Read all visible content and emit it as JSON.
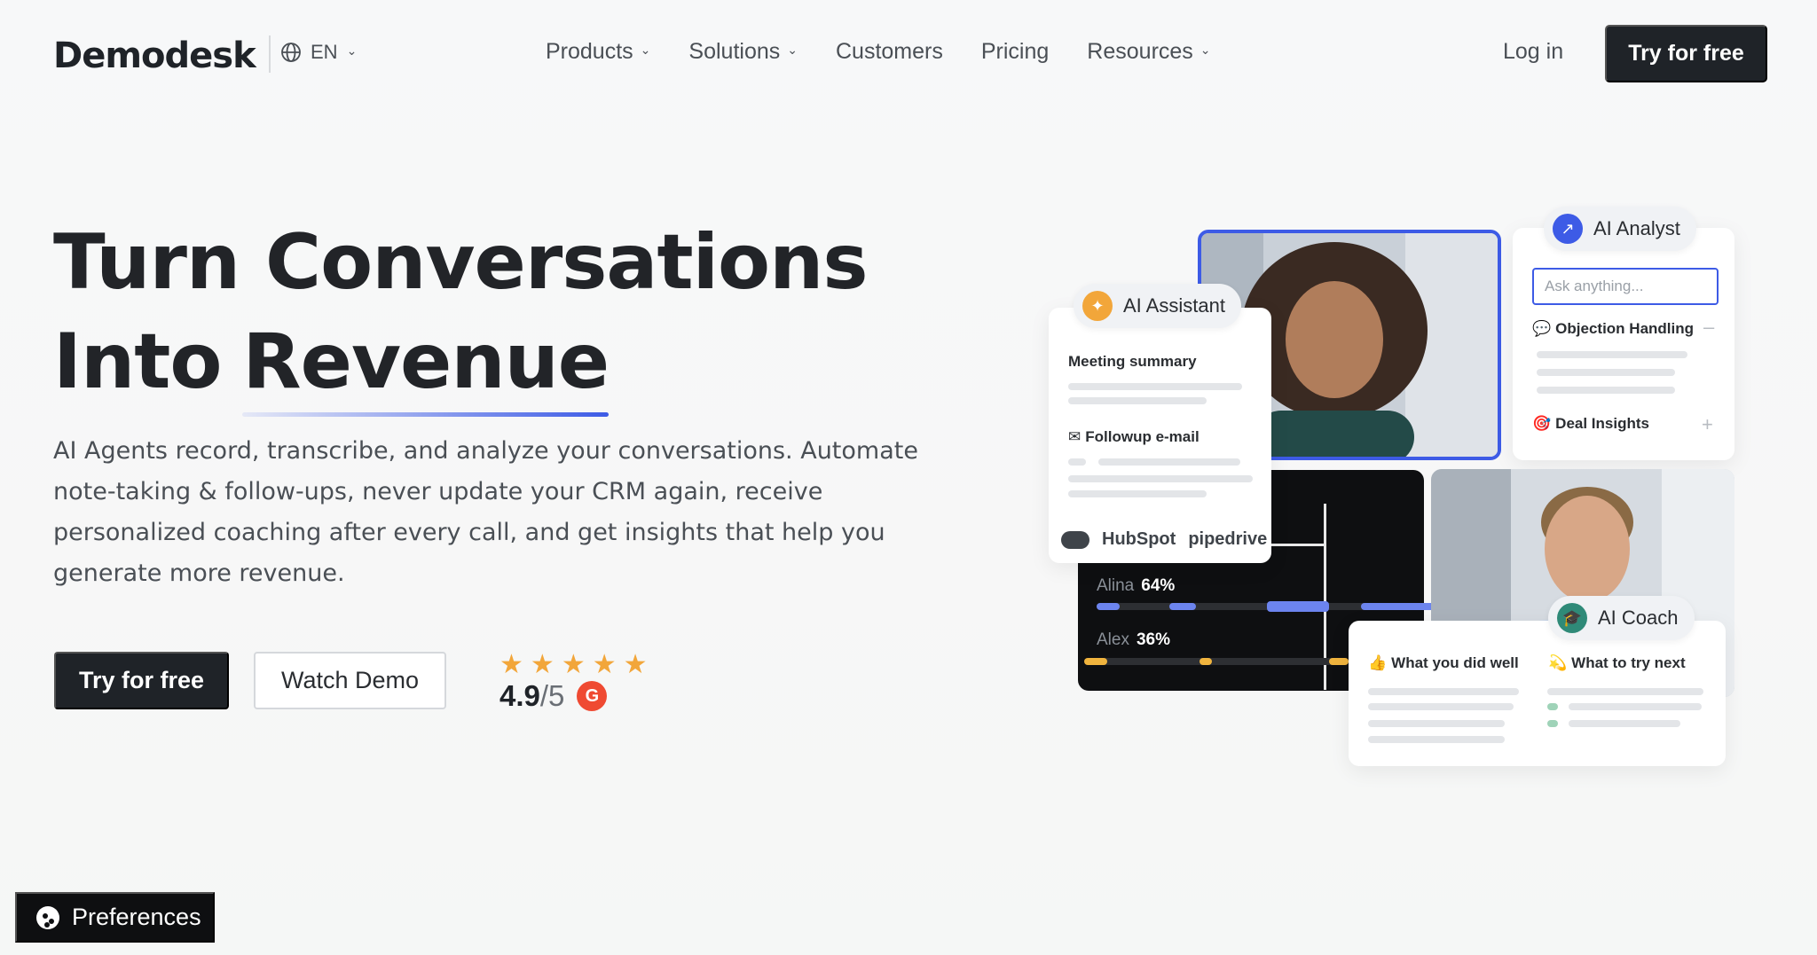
{
  "header": {
    "logo": "Demodesk",
    "language": "EN",
    "nav": [
      {
        "label": "Products",
        "has_dropdown": true
      },
      {
        "label": "Solutions",
        "has_dropdown": true
      },
      {
        "label": "Customers",
        "has_dropdown": false
      },
      {
        "label": "Pricing",
        "has_dropdown": false
      },
      {
        "label": "Resources",
        "has_dropdown": true
      }
    ],
    "login": "Log in",
    "cta": "Try for free"
  },
  "hero": {
    "title_line1": "Turn Conversations",
    "title_line2_a": "Into",
    "title_line2_b": "Revenue",
    "description": "AI Agents record, transcribe, and analyze your conversations. Automate note-taking & follow-ups, never update your CRM again, receive personalized coaching after every call, and get insights that help you generate more revenue.",
    "primary_button": "Try for free",
    "secondary_button": "Watch Demo",
    "stars": 5,
    "rating_score": "4.9",
    "rating_max": "/5",
    "rating_badge": "G"
  },
  "illustration": {
    "ai_assistant": {
      "label": "AI Assistant",
      "meeting_summary": "Meeting summary",
      "followup": "Followup e-mail",
      "crm_hubspot": "HubSpot",
      "crm_pipedrive": "pipedrive"
    },
    "ai_analyst": {
      "label": "AI Analyst",
      "placeholder": "Ask anything...",
      "objection": "Objection Handling",
      "deal": "Deal Insights"
    },
    "talk_ratio": {
      "speaker1": "Alina",
      "speaker1_pct": "64%",
      "speaker2": "Alex",
      "speaker2_pct": "36%"
    },
    "ai_coach": {
      "label": "AI Coach",
      "did_well": "What you did well",
      "try_next": "What to try next"
    }
  },
  "cookie": {
    "label": "Preferences"
  },
  "colors": {
    "accent": "#3d5be6",
    "dark": "#1f2328",
    "star": "#f2a63a",
    "g2": "#ef4a32"
  }
}
